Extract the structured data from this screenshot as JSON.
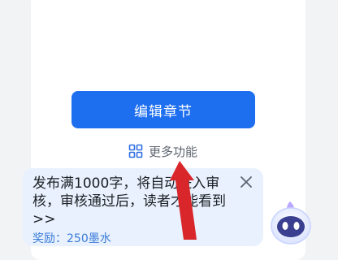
{
  "actions": {
    "edit_chapter_label": "编辑章节",
    "more_functions_label": "更多功能"
  },
  "tip": {
    "line1": "发布满1000字，将自动进入审",
    "line2": "核，审核通过后，读者才能看到",
    "line3": ">>",
    "reward": "奖励：250墨水"
  },
  "colors": {
    "primary": "#1e6ff0",
    "tip_background": "#e8f1fd",
    "annotation_arrow": "#d9262b"
  },
  "icons": {
    "more": "grid-icon",
    "close": "close-icon",
    "mascot": "assistant-mascot-icon"
  }
}
